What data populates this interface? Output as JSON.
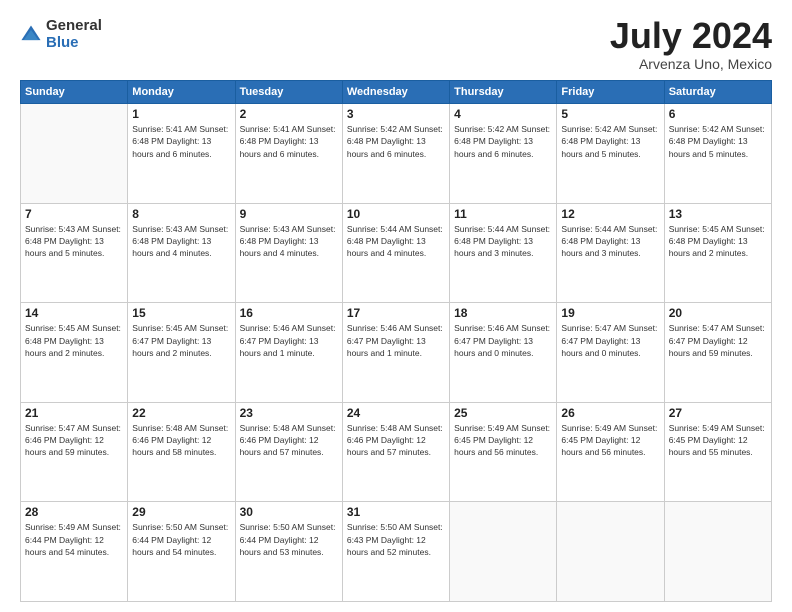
{
  "logo": {
    "general": "General",
    "blue": "Blue"
  },
  "title": {
    "month": "July 2024",
    "location": "Arvenza Uno, Mexico"
  },
  "weekdays": [
    "Sunday",
    "Monday",
    "Tuesday",
    "Wednesday",
    "Thursday",
    "Friday",
    "Saturday"
  ],
  "weeks": [
    [
      {
        "day": "",
        "info": ""
      },
      {
        "day": "1",
        "info": "Sunrise: 5:41 AM\nSunset: 6:48 PM\nDaylight: 13 hours\nand 6 minutes."
      },
      {
        "day": "2",
        "info": "Sunrise: 5:41 AM\nSunset: 6:48 PM\nDaylight: 13 hours\nand 6 minutes."
      },
      {
        "day": "3",
        "info": "Sunrise: 5:42 AM\nSunset: 6:48 PM\nDaylight: 13 hours\nand 6 minutes."
      },
      {
        "day": "4",
        "info": "Sunrise: 5:42 AM\nSunset: 6:48 PM\nDaylight: 13 hours\nand 6 minutes."
      },
      {
        "day": "5",
        "info": "Sunrise: 5:42 AM\nSunset: 6:48 PM\nDaylight: 13 hours\nand 5 minutes."
      },
      {
        "day": "6",
        "info": "Sunrise: 5:42 AM\nSunset: 6:48 PM\nDaylight: 13 hours\nand 5 minutes."
      }
    ],
    [
      {
        "day": "7",
        "info": "Sunrise: 5:43 AM\nSunset: 6:48 PM\nDaylight: 13 hours\nand 5 minutes."
      },
      {
        "day": "8",
        "info": "Sunrise: 5:43 AM\nSunset: 6:48 PM\nDaylight: 13 hours\nand 4 minutes."
      },
      {
        "day": "9",
        "info": "Sunrise: 5:43 AM\nSunset: 6:48 PM\nDaylight: 13 hours\nand 4 minutes."
      },
      {
        "day": "10",
        "info": "Sunrise: 5:44 AM\nSunset: 6:48 PM\nDaylight: 13 hours\nand 4 minutes."
      },
      {
        "day": "11",
        "info": "Sunrise: 5:44 AM\nSunset: 6:48 PM\nDaylight: 13 hours\nand 3 minutes."
      },
      {
        "day": "12",
        "info": "Sunrise: 5:44 AM\nSunset: 6:48 PM\nDaylight: 13 hours\nand 3 minutes."
      },
      {
        "day": "13",
        "info": "Sunrise: 5:45 AM\nSunset: 6:48 PM\nDaylight: 13 hours\nand 2 minutes."
      }
    ],
    [
      {
        "day": "14",
        "info": "Sunrise: 5:45 AM\nSunset: 6:48 PM\nDaylight: 13 hours\nand 2 minutes."
      },
      {
        "day": "15",
        "info": "Sunrise: 5:45 AM\nSunset: 6:47 PM\nDaylight: 13 hours\nand 2 minutes."
      },
      {
        "day": "16",
        "info": "Sunrise: 5:46 AM\nSunset: 6:47 PM\nDaylight: 13 hours\nand 1 minute."
      },
      {
        "day": "17",
        "info": "Sunrise: 5:46 AM\nSunset: 6:47 PM\nDaylight: 13 hours\nand 1 minute."
      },
      {
        "day": "18",
        "info": "Sunrise: 5:46 AM\nSunset: 6:47 PM\nDaylight: 13 hours\nand 0 minutes."
      },
      {
        "day": "19",
        "info": "Sunrise: 5:47 AM\nSunset: 6:47 PM\nDaylight: 13 hours\nand 0 minutes."
      },
      {
        "day": "20",
        "info": "Sunrise: 5:47 AM\nSunset: 6:47 PM\nDaylight: 12 hours\nand 59 minutes."
      }
    ],
    [
      {
        "day": "21",
        "info": "Sunrise: 5:47 AM\nSunset: 6:46 PM\nDaylight: 12 hours\nand 59 minutes."
      },
      {
        "day": "22",
        "info": "Sunrise: 5:48 AM\nSunset: 6:46 PM\nDaylight: 12 hours\nand 58 minutes."
      },
      {
        "day": "23",
        "info": "Sunrise: 5:48 AM\nSunset: 6:46 PM\nDaylight: 12 hours\nand 57 minutes."
      },
      {
        "day": "24",
        "info": "Sunrise: 5:48 AM\nSunset: 6:46 PM\nDaylight: 12 hours\nand 57 minutes."
      },
      {
        "day": "25",
        "info": "Sunrise: 5:49 AM\nSunset: 6:45 PM\nDaylight: 12 hours\nand 56 minutes."
      },
      {
        "day": "26",
        "info": "Sunrise: 5:49 AM\nSunset: 6:45 PM\nDaylight: 12 hours\nand 56 minutes."
      },
      {
        "day": "27",
        "info": "Sunrise: 5:49 AM\nSunset: 6:45 PM\nDaylight: 12 hours\nand 55 minutes."
      }
    ],
    [
      {
        "day": "28",
        "info": "Sunrise: 5:49 AM\nSunset: 6:44 PM\nDaylight: 12 hours\nand 54 minutes."
      },
      {
        "day": "29",
        "info": "Sunrise: 5:50 AM\nSunset: 6:44 PM\nDaylight: 12 hours\nand 54 minutes."
      },
      {
        "day": "30",
        "info": "Sunrise: 5:50 AM\nSunset: 6:44 PM\nDaylight: 12 hours\nand 53 minutes."
      },
      {
        "day": "31",
        "info": "Sunrise: 5:50 AM\nSunset: 6:43 PM\nDaylight: 12 hours\nand 52 minutes."
      },
      {
        "day": "",
        "info": ""
      },
      {
        "day": "",
        "info": ""
      },
      {
        "day": "",
        "info": ""
      }
    ]
  ]
}
